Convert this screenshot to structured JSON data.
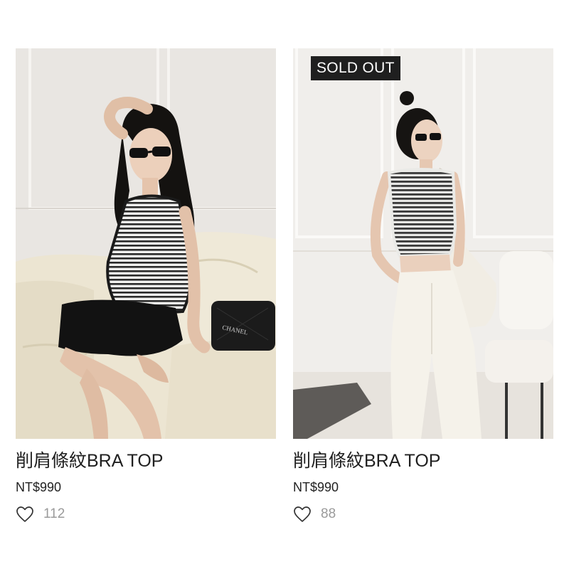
{
  "products": [
    {
      "title": "削肩條紋BRA TOP",
      "price": "NT$990",
      "likes": "112",
      "like_icon": "heart-outline-icon",
      "bag_text": "CHANEL"
    },
    {
      "badge": "SOLD OUT",
      "title": "削肩條紋BRA TOP",
      "price": "NT$990",
      "likes": "88",
      "like_icon": "heart-outline-icon"
    }
  ],
  "colors": {
    "badge_bg": "#1f1f1f",
    "text": "#1f1f1f",
    "muted": "#9a9a9a"
  }
}
